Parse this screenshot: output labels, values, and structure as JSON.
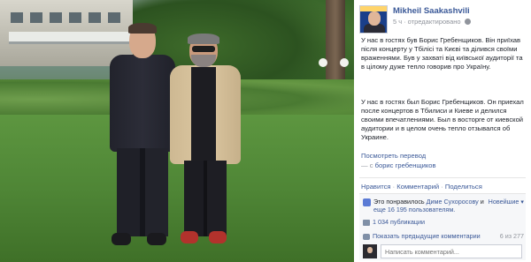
{
  "post": {
    "author": "Mikheil Saakashvili",
    "time": "5 ч",
    "edited": "отредактировано",
    "text_uk": "У нас в гостях був Борис Гребенщиков. Він приїхав після концерту у Тбілісі та Києві та ділився своїми враженнями. Був у захваті від київської аудиторії та в цілому дуже тепло говорив про Україну.",
    "text_ru": "У нас в гостях был Борис Гребенщиков. Он приехал после концертов в Тбилиси и Киеве и делился своими впечатлениями. Был в восторге от киевской аудитории и в целом очень тепло отзывался об Украине.",
    "see_translation": "Посмотреть перевод",
    "with_prefix": "— с",
    "tagged": "борис гребенщиков"
  },
  "actions": {
    "like": "Нравится",
    "comment": "Комментарий",
    "share": "Поделиться",
    "sep": "·"
  },
  "engagement": {
    "likes_prefix": "Это понравилось",
    "likes_name": "Диме Сухоросову",
    "likes_and": "и",
    "likes_others": "еще 16 195 пользователям.",
    "sort": "Новейшие ▾",
    "shares": "1 034 публикации",
    "prev_comments": "Показать предыдущие комментарии",
    "count": "6 из 277",
    "comment_placeholder": "Написать комментарий..."
  }
}
